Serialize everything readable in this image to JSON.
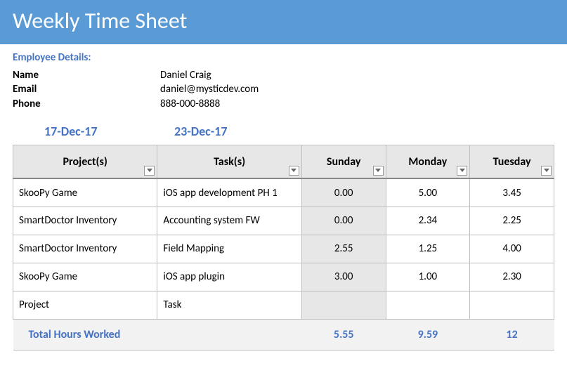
{
  "header": {
    "title": "Weekly Time Sheet"
  },
  "employee": {
    "section_title": "Employee Details:",
    "fields": [
      {
        "label": "Name",
        "value": "Daniel Craig"
      },
      {
        "label": "Email",
        "value": "daniel@mysticdev.com"
      },
      {
        "label": "Phone",
        "value": "888-000-8888"
      }
    ]
  },
  "dates": {
    "start": "17-Dec-17",
    "end": "23-Dec-17"
  },
  "table": {
    "headers": {
      "project": "Project(s)",
      "task": "Task(s)",
      "sunday": "Sunday",
      "monday": "Monday",
      "tuesday": "Tuesday"
    },
    "rows": [
      {
        "project": "SkooPy Game",
        "task": "iOS app development PH 1",
        "sunday": "0.00",
        "monday": "5.00",
        "tuesday": "3.45"
      },
      {
        "project": "SmartDoctor Inventory",
        "task": "Accounting system FW",
        "sunday": "0.00",
        "monday": "2.34",
        "tuesday": "2.25"
      },
      {
        "project": "SmartDoctor Inventory",
        "task": "Field Mapping",
        "sunday": "2.55",
        "monday": "1.25",
        "tuesday": "4.00"
      },
      {
        "project": "SkooPy Game",
        "task": "iOS app plugin",
        "sunday": "3.00",
        "monday": "1.00",
        "tuesday": "2.30"
      },
      {
        "project": "Project",
        "task": "Task",
        "sunday": "",
        "monday": "",
        "tuesday": ""
      }
    ],
    "totals": {
      "label": "Total Hours Worked",
      "sunday": "5.55",
      "monday": "9.59",
      "tuesday": "12"
    }
  },
  "chart_data": {
    "type": "table",
    "title": "Weekly Time Sheet",
    "columns": [
      "Project(s)",
      "Task(s)",
      "Sunday",
      "Monday",
      "Tuesday"
    ],
    "rows": [
      [
        "SkooPy Game",
        "iOS app development PH 1",
        0.0,
        5.0,
        3.45
      ],
      [
        "SmartDoctor Inventory",
        "Accounting system FW",
        0.0,
        2.34,
        2.25
      ],
      [
        "SmartDoctor Inventory",
        "Field Mapping",
        2.55,
        1.25,
        4.0
      ],
      [
        "SkooPy Game",
        "iOS app plugin",
        3.0,
        1.0,
        2.3
      ]
    ],
    "totals": {
      "Sunday": 5.55,
      "Monday": 9.59,
      "Tuesday": 12
    }
  }
}
